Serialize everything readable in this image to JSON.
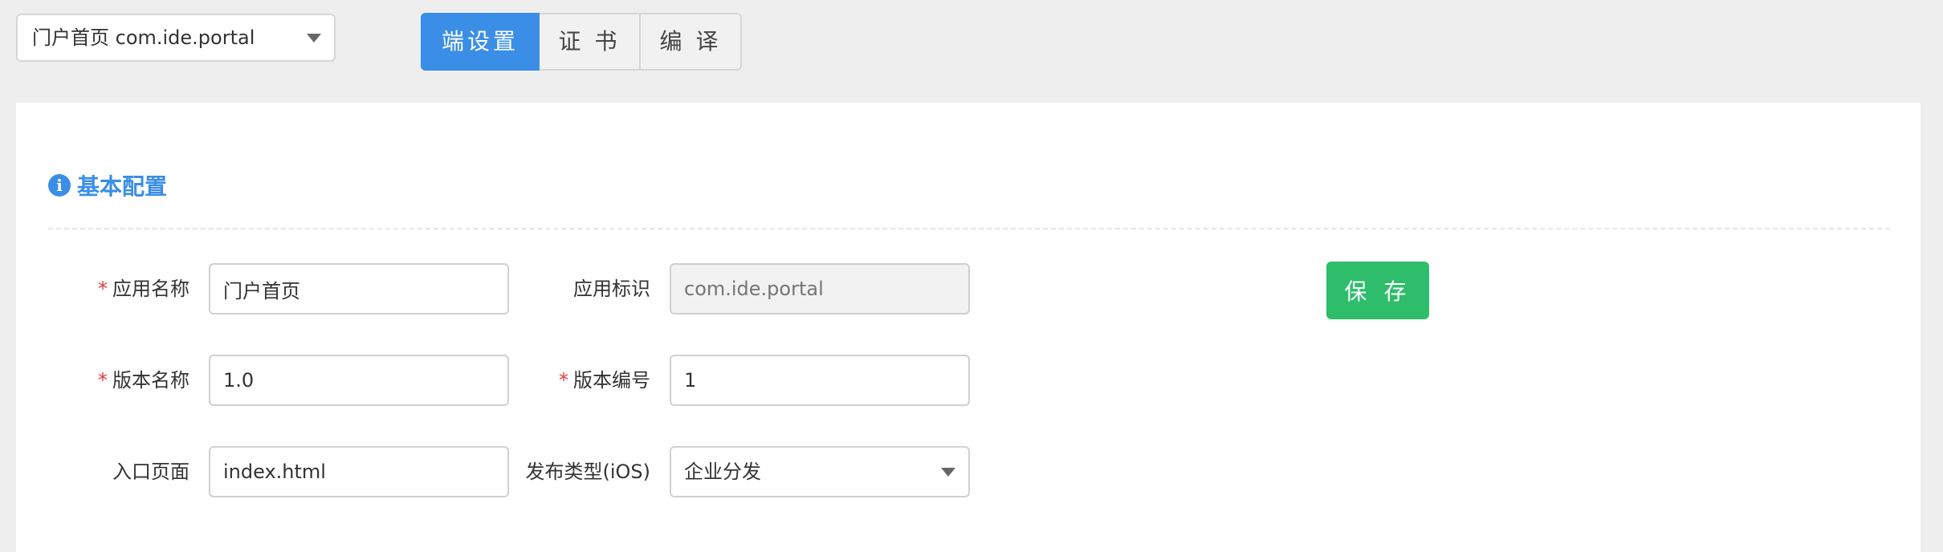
{
  "app_selector": {
    "value": "门户首页 com.ide.portal",
    "icon": "chevron-down-icon"
  },
  "tabs": [
    {
      "label": "端设置",
      "active": true
    },
    {
      "label": "证 书",
      "active": false
    },
    {
      "label": "编 译",
      "active": false
    }
  ],
  "section": {
    "icon": "info-icon",
    "icon_glyph": "i",
    "title": "基本配置"
  },
  "form": {
    "required_mark": "*",
    "app_name": {
      "label": "应用名称",
      "value": "门户首页",
      "required": true
    },
    "app_id": {
      "label": "应用标识",
      "placeholder": "com.ide.portal",
      "disabled": true
    },
    "version_name": {
      "label": "版本名称",
      "value": "1.0",
      "required": true
    },
    "version_code": {
      "label": "版本编号",
      "value": "1",
      "required": true
    },
    "entry_page": {
      "label": "入口页面",
      "value": "index.html"
    },
    "publish_type": {
      "label": "发布类型(iOS)",
      "value": "企业分发"
    }
  },
  "actions": {
    "save_label": "保 存"
  },
  "colors": {
    "primary": "#3a8ee6",
    "save": "#2ebd6b",
    "required": "#e4393c",
    "background": "#eeeeee"
  }
}
